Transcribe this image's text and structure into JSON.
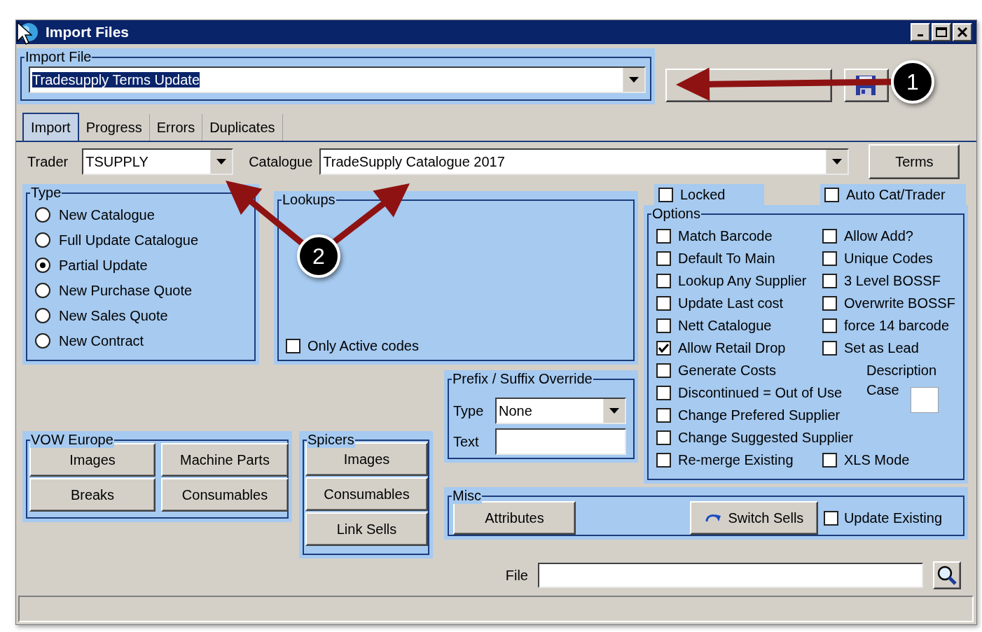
{
  "window": {
    "title": "Import Files"
  },
  "import_file": {
    "label": "Import File",
    "value": "Tradesupply Terms Update",
    "text_selected": true
  },
  "top_buttons": [
    {
      "kind": "load"
    },
    {
      "kind": "save"
    }
  ],
  "tabs": [
    {
      "label": "Import",
      "selected": true
    },
    {
      "label": "Progress",
      "selected": false
    },
    {
      "label": "Errors",
      "selected": false
    },
    {
      "label": "Duplicates",
      "selected": false
    }
  ],
  "trader": {
    "label": "Trader",
    "value": "TSUPPLY"
  },
  "catalogue": {
    "label": "Catalogue",
    "value": "TradeSupply Catalogue 2017"
  },
  "terms_button": "Terms",
  "type_group": {
    "title": "Type",
    "options": [
      {
        "label": "New Catalogue",
        "selected": false
      },
      {
        "label": "Full Update Catalogue",
        "selected": false
      },
      {
        "label": "Partial Update",
        "selected": true
      },
      {
        "label": "New Purchase Quote",
        "selected": false
      },
      {
        "label": "New Sales Quote",
        "selected": false
      },
      {
        "label": "New Contract",
        "selected": false
      }
    ]
  },
  "lookups": {
    "title": "Lookups",
    "only_active": {
      "label": "Only Active codes",
      "checked": false
    }
  },
  "locked": {
    "label": "Locked",
    "checked": false
  },
  "auto_cat_trader": {
    "label": "Auto Cat/Trader",
    "checked": false
  },
  "options": {
    "title": "Options",
    "left": [
      {
        "label": "Match Barcode",
        "checked": false
      },
      {
        "label": "Default To Main",
        "checked": false
      },
      {
        "label": "Lookup Any Supplier",
        "checked": false
      },
      {
        "label": "Update Last cost",
        "checked": false
      },
      {
        "label": "Nett Catalogue",
        "checked": false
      },
      {
        "label": "Allow Retail Drop",
        "checked": true
      },
      {
        "label": "Generate Costs",
        "checked": false
      },
      {
        "label": "Discontinued = Out of Use",
        "checked": false
      },
      {
        "label": "Change Prefered Supplier",
        "checked": false
      },
      {
        "label": "Change Suggested Supplier",
        "checked": false
      },
      {
        "label": "Re-merge Existing",
        "checked": false
      }
    ],
    "right": [
      {
        "label": "Allow Add?",
        "checked": false
      },
      {
        "label": "Unique Codes",
        "checked": false
      },
      {
        "label": "3 Level BOSSF",
        "checked": false
      },
      {
        "label": "Overwrite BOSSF",
        "checked": false
      },
      {
        "label": "force 14 barcode",
        "checked": false
      },
      {
        "label": "Set as Lead",
        "checked": false
      }
    ],
    "description_case": "Description Case",
    "xls_mode": {
      "label": "XLS Mode",
      "checked": false
    }
  },
  "prefix_suffix": {
    "title": "Prefix / Suffix Override",
    "type_label": "Type",
    "type_value": "None",
    "text_label": "Text"
  },
  "vow_europe": {
    "title": "VOW Europe",
    "buttons": [
      "Images",
      "Machine Parts",
      "Breaks",
      "Consumables"
    ]
  },
  "spicers": {
    "title": "Spicers",
    "buttons": [
      "Images",
      "Consumables",
      "Link Sells"
    ]
  },
  "misc": {
    "title": "Misc",
    "attributes_button": "Attributes",
    "switch_sells_button": "Switch Sells",
    "update_existing": {
      "label": "Update Existing",
      "checked": false
    }
  },
  "file": {
    "label": "File"
  },
  "annotations": [
    {
      "number": "1"
    },
    {
      "number": "2"
    }
  ]
}
